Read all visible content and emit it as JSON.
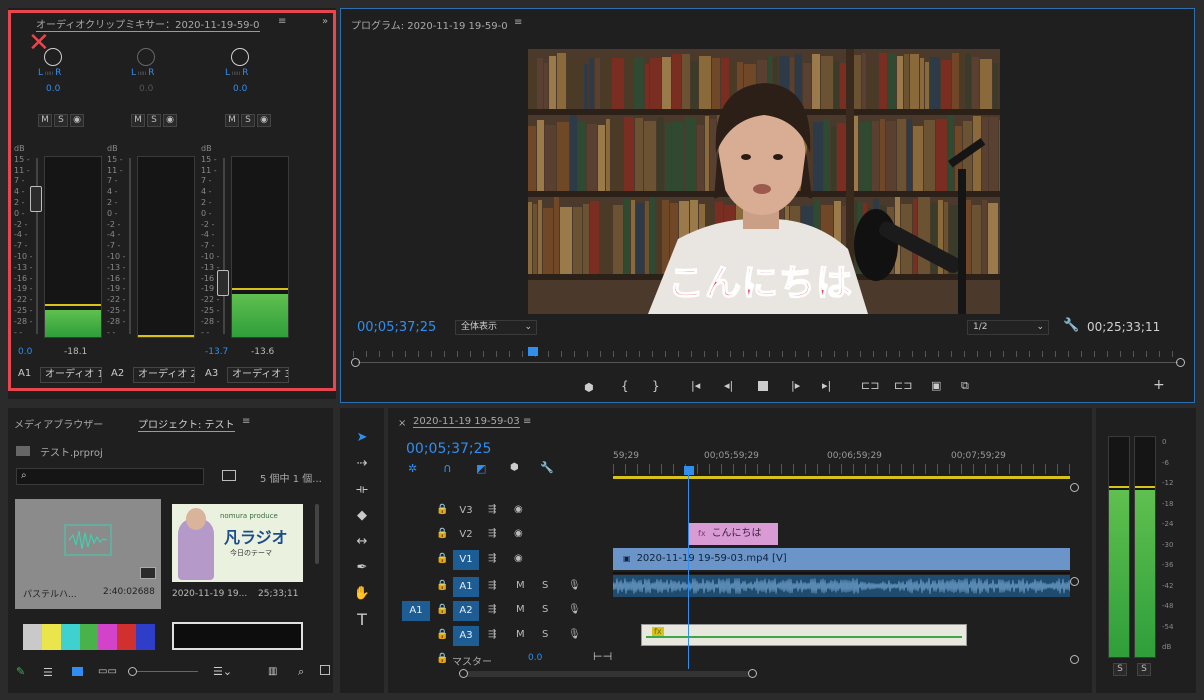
{
  "audio_mixer": {
    "title": "オーディオクリップミキサー：2020-11-19-59-0",
    "channels": [
      {
        "id": "A1",
        "name": "オーディオ 1",
        "pan": "0.0",
        "level": "0.0",
        "peak": "-18.1",
        "meter_fill": 0.15
      },
      {
        "id": "A2",
        "name": "オーディオ 2",
        "pan": "0.0",
        "level": "",
        "peak": "",
        "meter_fill": 0.0
      },
      {
        "id": "A3",
        "name": "オーディオ 3",
        "pan": "0.0",
        "level": "-13.7",
        "peak": "-13.6",
        "meter_fill": 0.24
      }
    ],
    "db_ticks": [
      "dB",
      "15 -",
      "11 -",
      "7 -",
      "4 -",
      "2 -",
      "0 -",
      "-2 -",
      "-4 -",
      "-7 -",
      "-10 -",
      "-13 -",
      "-16 -",
      "-19 -",
      "-22 -",
      "-25 -",
      "-28 -",
      "- -"
    ],
    "msr": [
      "M",
      "S",
      "◉"
    ]
  },
  "program": {
    "title": "プログラム: 2020-11-19 19-59-0",
    "timecode_in": "00;05;37;25",
    "fit": "全体表示",
    "resolution": "1/2",
    "duration": "00;25;33;11",
    "subtitle": "こんにちは"
  },
  "project": {
    "tab_media": "メディアブラウザー",
    "tab_project": "プロジェクト: テスト",
    "file": "テスト.prproj",
    "count": "5 個中 1 個...",
    "items": [
      {
        "name": "パステルハ...",
        "duration": "2:40:02688"
      },
      {
        "name": "2020-11-19 19...",
        "duration": "25;33;11",
        "thumb_title": "凡ラジオ",
        "thumb_sub": "nomura produce",
        "thumb_line": "今日のテーマ"
      }
    ]
  },
  "timeline": {
    "tab": "2020-11-19 19-59-03",
    "timecode": "00;05;37;25",
    "ruler": [
      "59;29",
      "00;05;59;29",
      "00;06;59;29",
      "00;07;59;29"
    ],
    "tracks": [
      {
        "name": "V3",
        "type": "video",
        "on": false
      },
      {
        "name": "V2",
        "type": "video",
        "on": false
      },
      {
        "name": "V1",
        "type": "video",
        "on": true
      },
      {
        "name": "A1",
        "type": "audio",
        "on": true
      },
      {
        "name": "A2",
        "type": "audio",
        "on": true
      },
      {
        "name": "A3",
        "type": "audio",
        "on": true
      }
    ],
    "source_a1": "A1",
    "master_label": "マスター",
    "master_value": "0.0",
    "clips": {
      "v2_title": "こんにちは",
      "v1_name": "2020-11-19 19-59-03.mp4 [V]"
    }
  },
  "master_meter": {
    "ticks": [
      "0",
      "-6",
      "-12",
      "-18",
      "-24",
      "-30",
      "-36",
      "-42",
      "-48",
      "-54",
      "dB"
    ],
    "solo": [
      "S",
      "S"
    ]
  },
  "colors": {
    "accent": "#2f8ef0",
    "highlight": "#e8464e",
    "meter": "#3aa84a"
  }
}
